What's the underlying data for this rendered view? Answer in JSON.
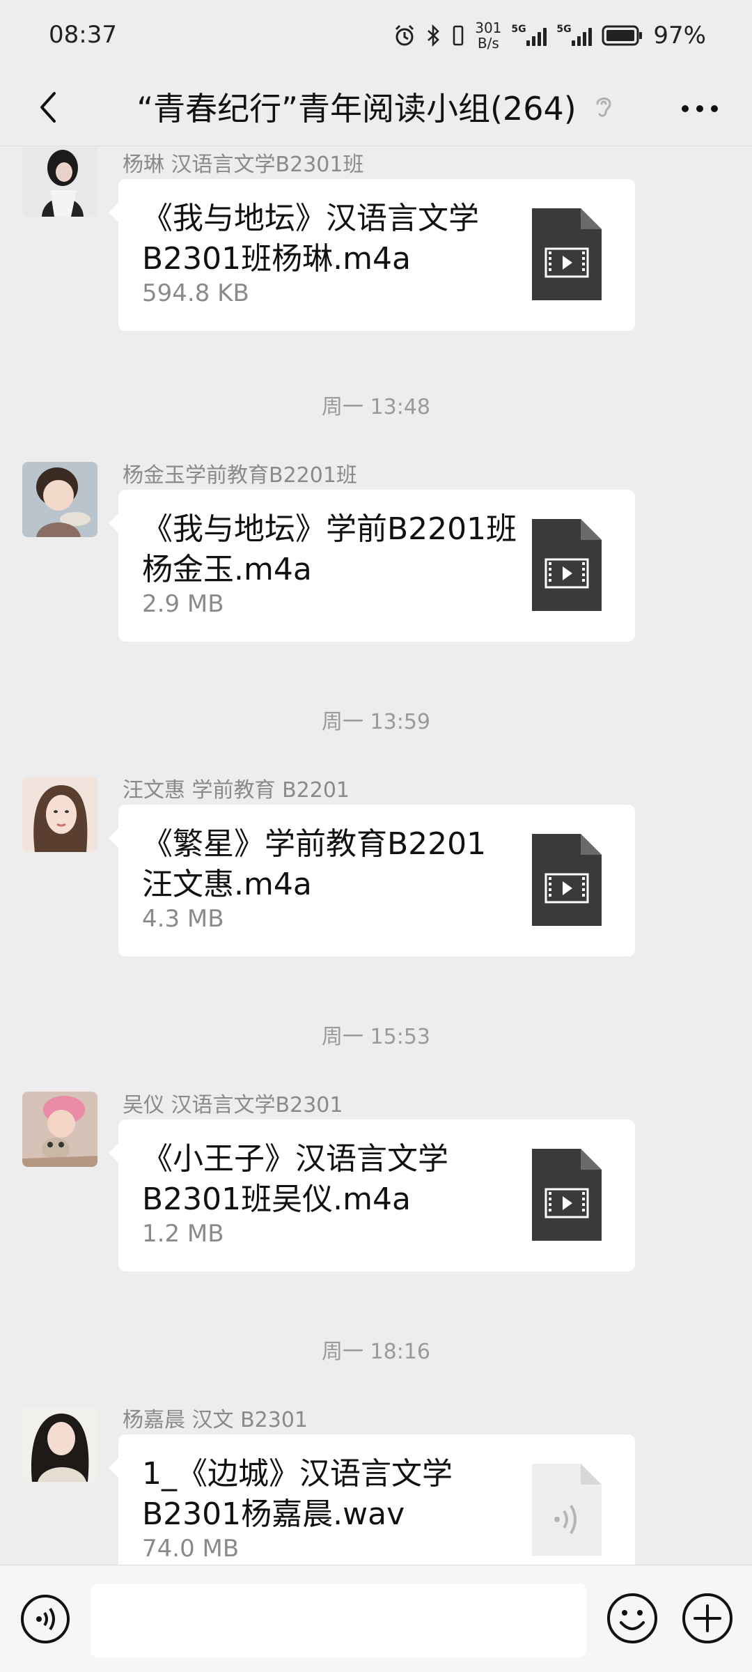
{
  "status": {
    "time": "08:37",
    "speed_value": "301",
    "speed_unit": "B/s",
    "network_tag_1": "5G",
    "network_tag_2": "5G",
    "battery": "97%",
    "icons": [
      "alarm-icon",
      "bluetooth-icon",
      "battery-icon"
    ]
  },
  "header": {
    "title": "“青春纪行”青年阅读小组(264)",
    "icons": [
      "back-icon",
      "mute-ear-icon",
      "more-icon"
    ]
  },
  "messages": [
    {
      "sender": "杨琳 汉语言文学B2301班",
      "file_line1": "《我与地坛》汉语言文学",
      "file_line2": "B2301班杨琳.m4a",
      "size": "594.8 KB",
      "file_type": "video-file-icon"
    },
    {
      "sender": "杨金玉学前教育B2201班",
      "file_line1": "《我与地坛》学前B2201班",
      "file_line2": "杨金玉.m4a",
      "size": "2.9 MB",
      "file_type": "video-file-icon"
    },
    {
      "sender": "汪文惠 学前教育 B2201",
      "file_line1": "《繁星》学前教育B2201",
      "file_line2": "汪文惠.m4a",
      "size": "4.3 MB",
      "file_type": "video-file-icon"
    },
    {
      "sender": "吴仪 汉语言文学B2301",
      "file_line1": "《小王子》汉语言文学",
      "file_line2": "B2301班吴仪.m4a",
      "size": "1.2 MB",
      "file_type": "video-file-icon"
    },
    {
      "sender": "杨嘉晨 汉文 B2301",
      "file_line1": "1_《边城》汉语言文学",
      "file_line2": "B2301杨嘉晨.wav",
      "size": "74.0 MB",
      "file_type": "audio-file-icon"
    }
  ],
  "time_separators": [
    "周一 13:48",
    "周一 13:59",
    "周一 15:53",
    "周一 18:16"
  ],
  "input": {
    "icons": [
      "voice-icon",
      "emoji-icon",
      "plus-icon"
    ]
  }
}
